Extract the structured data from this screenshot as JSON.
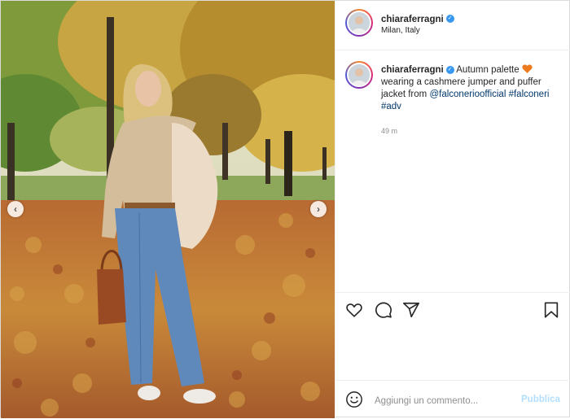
{
  "post": {
    "username": "chiaraferragni",
    "location": "Milan, Italy",
    "caption": {
      "username": "chiaraferragni",
      "text_1": "Autumn palette",
      "text_2": "wearing a cashmere jumper and puffer jacket from",
      "mention": "@falconerioofficial",
      "hashtag_1": "#falconeri",
      "hashtag_2": "#adv"
    },
    "timestamp": "49 m"
  },
  "comment": {
    "placeholder": "Aggiungi un commento...",
    "publish_label": "Pubblica"
  },
  "colors": {
    "link": "#00376b",
    "verified": "#3897f0",
    "publish_disabled": "#b2dffc",
    "heart": "#ed7a1c"
  },
  "icons": [
    "chevron-left-icon",
    "chevron-right-icon",
    "heart-icon",
    "comment-icon",
    "share-icon",
    "bookmark-icon",
    "emoji-icon",
    "verified-icon"
  ]
}
